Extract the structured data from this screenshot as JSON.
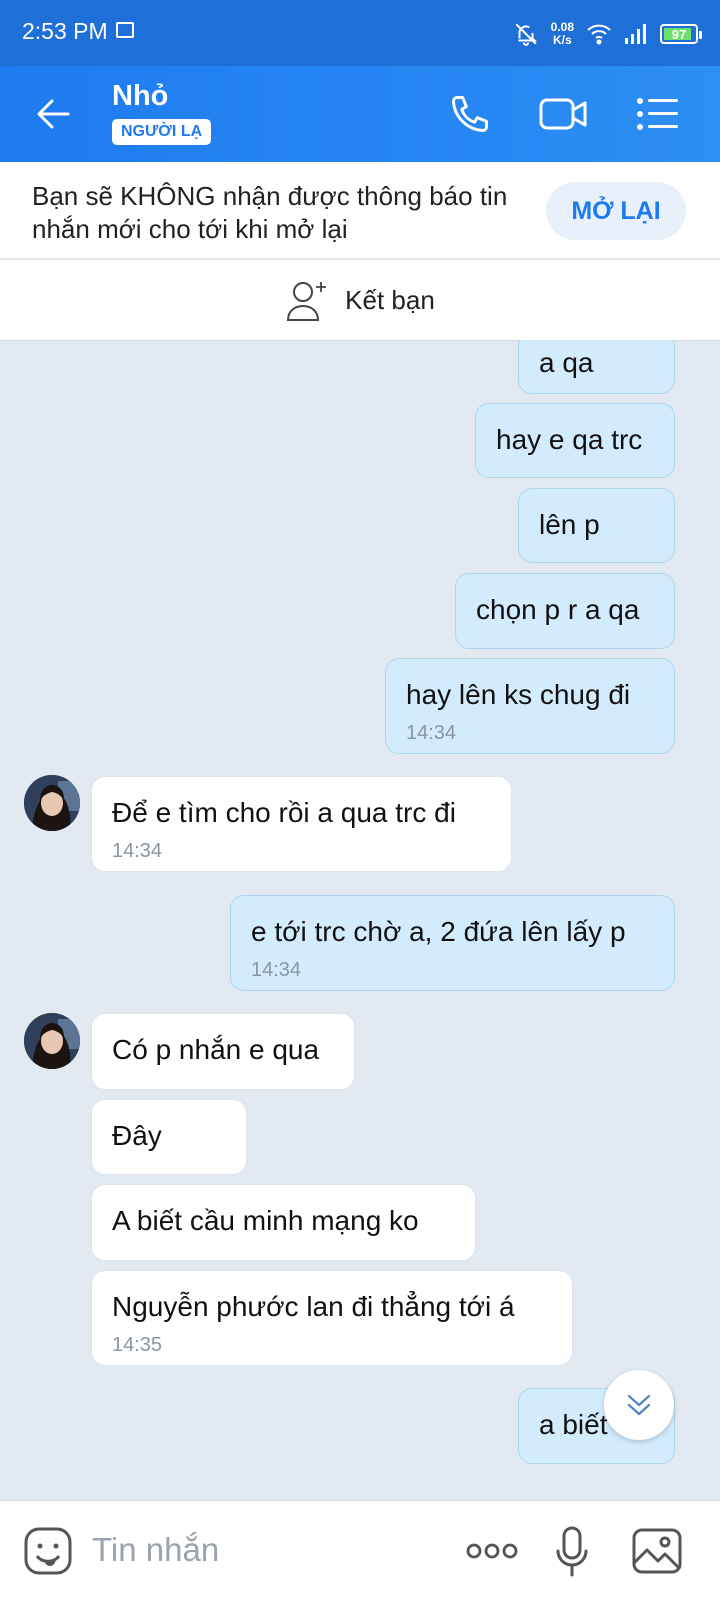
{
  "status": {
    "time": "2:53 PM",
    "net_speed": "0.08",
    "net_unit": "K/s",
    "battery": "97"
  },
  "header": {
    "title": "Nhỏ",
    "badge": "NGƯỜI LẠ"
  },
  "notice": {
    "text": "Bạn sẽ KHÔNG nhận được thông báo tin nhắn mới cho tới khi mở lại",
    "button": "MỞ LẠI"
  },
  "add_friend": {
    "label": "Kết bạn"
  },
  "messages": [
    {
      "from": "me",
      "text": "a qa"
    },
    {
      "from": "me",
      "text": "hay e qa trc"
    },
    {
      "from": "me",
      "text": "lên p"
    },
    {
      "from": "me",
      "text": "chọn p r a qa"
    },
    {
      "from": "me",
      "text": "hay lên ks chug đi",
      "time": "14:34"
    },
    {
      "from": "them",
      "text": "Để e tìm cho rồi a qua trc đi",
      "time": "14:34"
    },
    {
      "from": "me",
      "text": "e tới trc chờ a, 2 đứa lên lấy p",
      "time": "14:34"
    },
    {
      "from": "them",
      "text": "Có p nhắn e qua"
    },
    {
      "from": "them",
      "text": "Đây"
    },
    {
      "from": "them",
      "text": "A biết cầu minh mạng ko"
    },
    {
      "from": "them",
      "text": "Nguyễn phước lan đi thẳng tới á",
      "time": "14:35"
    },
    {
      "from": "me",
      "text": "a biết"
    }
  ],
  "input": {
    "placeholder": "Tin nhắn"
  },
  "icons": {
    "back": "arrow-left-icon",
    "call": "phone-icon",
    "video": "video-camera-icon",
    "menu": "list-menu-icon",
    "add_friend": "person-add-icon",
    "emoji": "emoji-icon",
    "more": "more-dots-icon",
    "mic": "microphone-icon",
    "gallery": "image-icon",
    "scroll": "double-chevron-down-icon"
  },
  "colors": {
    "accent": "#1e7bef",
    "my_bubble": "#d3ecfd",
    "their_bubble": "#ffffff",
    "chat_bg": "#e2e9f1"
  }
}
